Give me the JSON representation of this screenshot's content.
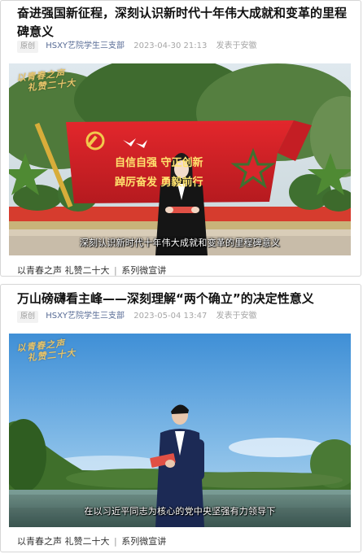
{
  "articles": [
    {
      "title": "奋进强国新征程，深刻认识新时代十年伟大成就和变革的里程碑意义",
      "tag": "原创",
      "account": "HSXY艺院学生三支部",
      "time": "2023-04-30 21:13",
      "location": "发表于安徽",
      "video": {
        "logo_line1": "以青春之声",
        "logo_line2": "礼赞二十大",
        "sign_line1": "自信自强  守正创新",
        "sign_line2": "踔厉奋发  勇毅前行",
        "subtitle": "深刻认识新时代十年伟大成就和变革的里程碑意义"
      },
      "footer": {
        "topic1": "以青春之声 礼赞二十大",
        "separator": "|",
        "topic2": "系列微宣讲"
      }
    },
    {
      "title": "万山磅礴看主峰——深刻理解“两个确立”的决定性意义",
      "tag": "原创",
      "account": "HSXY艺院学生三支部",
      "time": "2023-05-04 13:47",
      "location": "发表于安徽",
      "video": {
        "logo_line1": "以青春之声",
        "logo_line2": "礼赞二十大",
        "subtitle": "在以习近平同志为核心的党中央坚强有力领导下"
      },
      "footer": {
        "topic1": "以青春之声 礼赞二十大",
        "separator": "|",
        "topic2": "系列微宣讲"
      }
    }
  ]
}
